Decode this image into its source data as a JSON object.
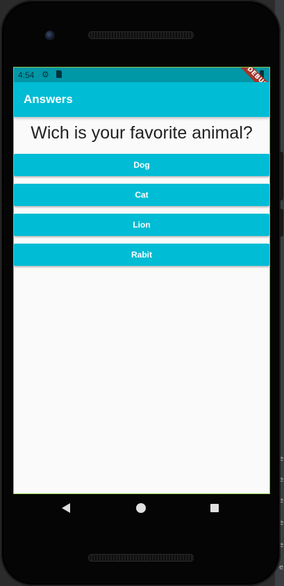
{
  "status_bar": {
    "time": "4:54",
    "settings_icon": "gear-icon",
    "sd_icon": "sd-card-icon",
    "debug_label": "DEBUG"
  },
  "app_bar": {
    "title": "Answers"
  },
  "question": {
    "text": "Wich is your favorite animal?"
  },
  "answers": [
    {
      "label": "Dog"
    },
    {
      "label": "Cat"
    },
    {
      "label": "Lion"
    },
    {
      "label": "Rabit"
    }
  ],
  "nav_bar": {
    "back_icon": "back-triangle-icon",
    "home_icon": "home-circle-icon",
    "recents_icon": "recents-square-icon"
  },
  "colors": {
    "primary": "#00bcd4",
    "status_bar": "#0097a7",
    "screen_background": "#fafafa",
    "debug_banner": "#a0372d"
  }
}
